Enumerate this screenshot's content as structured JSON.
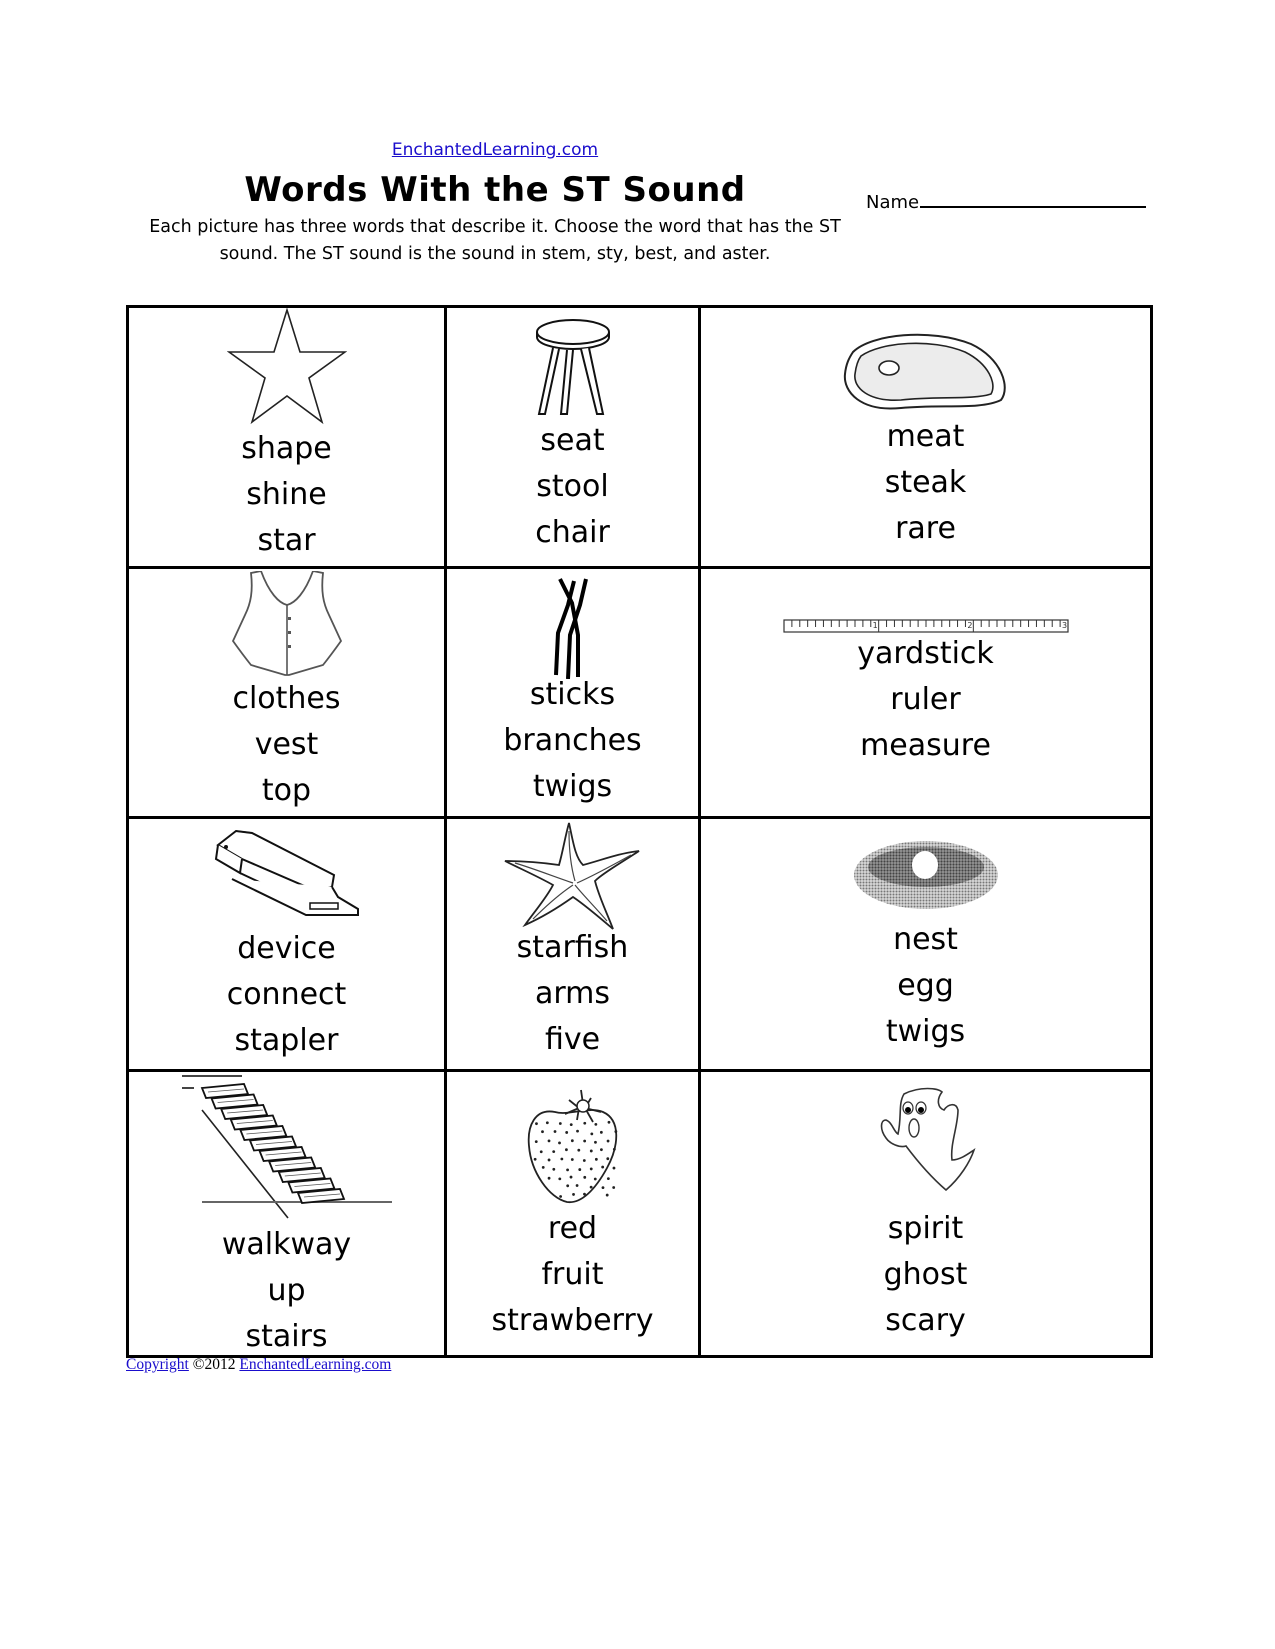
{
  "header": {
    "site_link": "EnchantedLearning.com",
    "title": "Words With the ST Sound",
    "instructions_line1": "Each picture has three words that describe it. Choose the word that has the ST",
    "instructions_line2": "sound. The ST sound is the sound in stem, sty, best, and aster.",
    "name_label": "Name"
  },
  "grid": {
    "rows": [
      [
        {
          "picture": "star-icon",
          "words": [
            "shape",
            "shine",
            "star"
          ]
        },
        {
          "picture": "stool-icon",
          "words": [
            "seat",
            "stool",
            "chair"
          ]
        },
        {
          "picture": "steak-icon",
          "words": [
            "meat",
            "steak",
            "rare"
          ]
        }
      ],
      [
        {
          "picture": "vest-icon",
          "words": [
            "clothes",
            "vest",
            "top"
          ]
        },
        {
          "picture": "sticks-icon",
          "words": [
            "sticks",
            "branches",
            "twigs"
          ]
        },
        {
          "picture": "yardstick-icon",
          "words": [
            "yardstick",
            "ruler",
            "measure"
          ],
          "ruler_marks": [
            "1",
            "2",
            "3"
          ]
        }
      ],
      [
        {
          "picture": "stapler-icon",
          "words": [
            "device",
            "connect",
            "stapler"
          ]
        },
        {
          "picture": "starfish-icon",
          "words": [
            "starfish",
            "arms",
            "five"
          ]
        },
        {
          "picture": "nest-icon",
          "words": [
            "nest",
            "egg",
            "twigs"
          ]
        }
      ],
      [
        {
          "picture": "stairs-icon",
          "words": [
            "walkway",
            "up",
            "stairs"
          ]
        },
        {
          "picture": "strawberry-icon",
          "words": [
            "red",
            "fruit",
            "strawberry"
          ]
        },
        {
          "picture": "ghost-icon",
          "words": [
            "spirit",
            "ghost",
            "scary"
          ]
        }
      ]
    ]
  },
  "footer": {
    "copyright_link": "Copyright",
    "year_text": "©2012",
    "site_link": "EnchantedLearning.com"
  }
}
